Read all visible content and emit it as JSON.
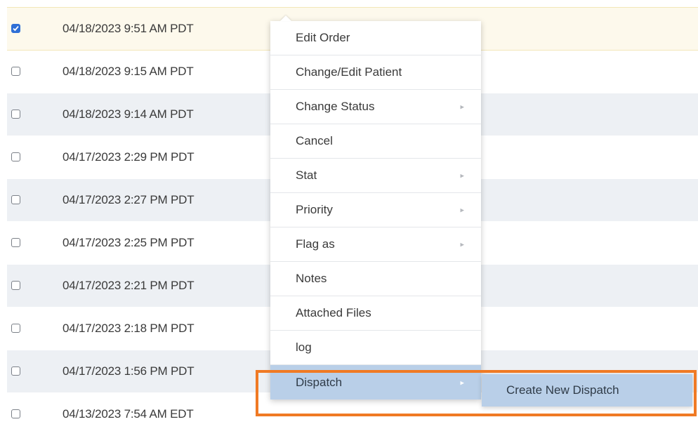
{
  "rows": [
    {
      "date": "04/18/2023 9:51 AM PDT",
      "checked": true
    },
    {
      "date": "04/18/2023 9:15 AM PDT",
      "checked": false
    },
    {
      "date": "04/18/2023 9:14 AM PDT",
      "checked": false
    },
    {
      "date": "04/17/2023 2:29 PM PDT",
      "checked": false
    },
    {
      "date": "04/17/2023 2:27 PM PDT",
      "checked": false
    },
    {
      "date": "04/17/2023 2:25 PM PDT",
      "checked": false
    },
    {
      "date": "04/17/2023 2:21 PM PDT",
      "checked": false
    },
    {
      "date": "04/17/2023 2:18 PM PDT",
      "checked": false
    },
    {
      "date": "04/17/2023 1:56 PM PDT",
      "checked": false
    },
    {
      "date": "04/13/2023 7:54 AM EDT",
      "checked": false
    }
  ],
  "context_menu": {
    "items": [
      {
        "label": "Edit Order",
        "has_submenu": false
      },
      {
        "label": "Change/Edit Patient",
        "has_submenu": false
      },
      {
        "label": "Change Status",
        "has_submenu": true
      },
      {
        "label": "Cancel",
        "has_submenu": false
      },
      {
        "label": "Stat",
        "has_submenu": true
      },
      {
        "label": "Priority",
        "has_submenu": true
      },
      {
        "label": "Flag as",
        "has_submenu": true
      },
      {
        "label": "Notes",
        "has_submenu": false
      },
      {
        "label": "Attached Files",
        "has_submenu": false
      },
      {
        "label": "log",
        "has_submenu": false
      },
      {
        "label": "Dispatch",
        "has_submenu": true,
        "active": true
      }
    ],
    "submenu": {
      "items": [
        {
          "label": "Create New Dispatch"
        }
      ]
    }
  },
  "colors": {
    "checkbox_checked": "#2f6fd6",
    "selected_row": "#fdf9ec",
    "alt_row": "#edf0f4",
    "active_menu": "#b9cfe8",
    "highlight_border": "#f07a24"
  },
  "icons": {
    "submenu_arrow": "chevron-right-icon",
    "checkbox_check": "check-icon"
  }
}
